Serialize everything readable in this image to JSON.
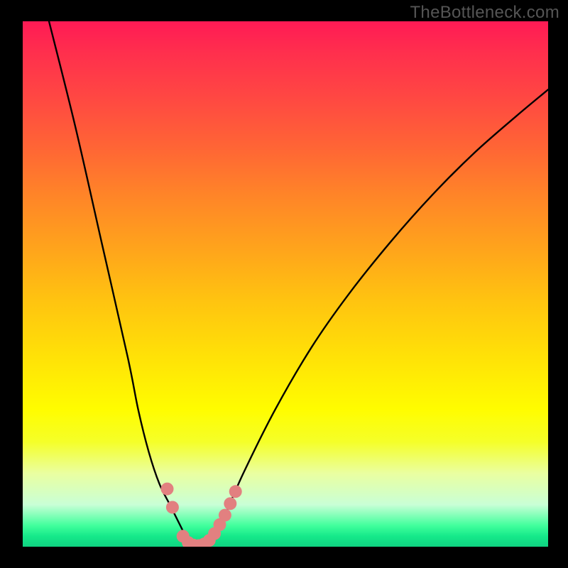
{
  "watermark": "TheBottleneck.com",
  "chart_data": {
    "type": "line",
    "title": "",
    "xlabel": "",
    "ylabel": "",
    "xlim": [
      0,
      100
    ],
    "ylim": [
      0,
      100
    ],
    "series": [
      {
        "name": "bottleneck-curve",
        "x": [
          5,
          10,
          15,
          20,
          22,
          24,
          26,
          28,
          30,
          31,
          32,
          33,
          34,
          35,
          36,
          38,
          42,
          48,
          55,
          62,
          70,
          78,
          86,
          94,
          100
        ],
        "values": [
          100,
          80,
          58,
          36,
          26,
          18,
          12,
          8,
          4,
          2,
          0.5,
          0,
          0,
          0.5,
          2,
          5,
          14,
          26,
          38,
          48,
          58,
          67,
          75,
          82,
          87
        ]
      }
    ],
    "markers": {
      "name": "highlight-points",
      "color": "#e28080",
      "points": [
        {
          "x": 27.5,
          "y": 11
        },
        {
          "x": 28.5,
          "y": 7.5
        },
        {
          "x": 30.5,
          "y": 2
        },
        {
          "x": 31.5,
          "y": 0.8
        },
        {
          "x": 32.5,
          "y": 0.3
        },
        {
          "x": 33.5,
          "y": 0.2
        },
        {
          "x": 34.5,
          "y": 0.5
        },
        {
          "x": 35.5,
          "y": 1.2
        },
        {
          "x": 36.5,
          "y": 2.5
        },
        {
          "x": 37.5,
          "y": 4.2
        },
        {
          "x": 38.5,
          "y": 6.0
        },
        {
          "x": 39.5,
          "y": 8.2
        },
        {
          "x": 40.5,
          "y": 10.5
        }
      ]
    },
    "gradient_colors": {
      "top": "#ff1a55",
      "mid": "#ffe207",
      "bottom": "#15e98a"
    }
  }
}
